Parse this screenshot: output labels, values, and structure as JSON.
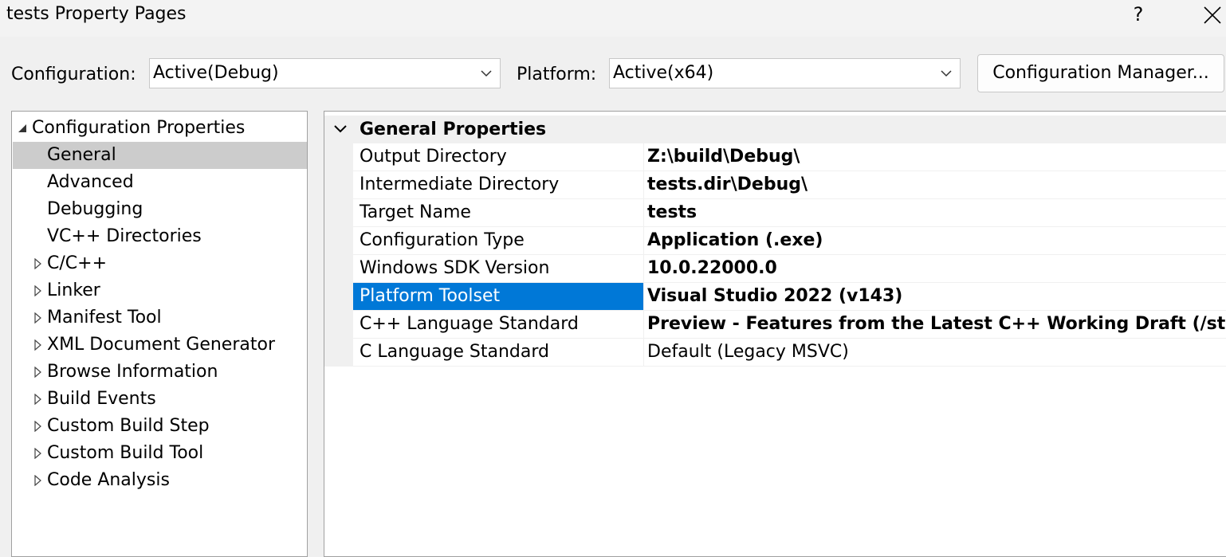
{
  "window": {
    "title": "tests Property Pages",
    "help_label": "?"
  },
  "toolbar": {
    "configuration_label": "Configuration:",
    "configuration_value": "Active(Debug)",
    "platform_label": "Platform:",
    "platform_value": "Active(x64)",
    "config_manager_label": "Configuration Manager..."
  },
  "tree": {
    "root": "Configuration Properties",
    "items": [
      {
        "label": "General",
        "selected": true,
        "expandable": false
      },
      {
        "label": "Advanced",
        "expandable": false
      },
      {
        "label": "Debugging",
        "expandable": false
      },
      {
        "label": "VC++ Directories",
        "expandable": false
      },
      {
        "label": "C/C++",
        "expandable": true
      },
      {
        "label": "Linker",
        "expandable": true
      },
      {
        "label": "Manifest Tool",
        "expandable": true
      },
      {
        "label": "XML Document Generator",
        "expandable": true
      },
      {
        "label": "Browse Information",
        "expandable": true
      },
      {
        "label": "Build Events",
        "expandable": true
      },
      {
        "label": "Custom Build Step",
        "expandable": true
      },
      {
        "label": "Custom Build Tool",
        "expandable": true
      },
      {
        "label": "Code Analysis",
        "expandable": true
      }
    ]
  },
  "properties": {
    "section_title": "General Properties",
    "rows": [
      {
        "name": "Output Directory",
        "value": "Z:\\build\\Debug\\"
      },
      {
        "name": "Intermediate Directory",
        "value": "tests.dir\\Debug\\"
      },
      {
        "name": "Target Name",
        "value": "tests"
      },
      {
        "name": "Configuration Type",
        "value": "Application (.exe)"
      },
      {
        "name": "Windows SDK Version",
        "value": "10.0.22000.0"
      },
      {
        "name": "Platform Toolset",
        "value": "Visual Studio 2022 (v143)"
      },
      {
        "name": "C++ Language Standard",
        "value": "Preview - Features from the Latest C++ Working Draft (/std:c++latest)"
      },
      {
        "name": "C Language Standard",
        "value": "Default (Legacy MSVC)"
      }
    ]
  },
  "colors": {
    "selection": "#0078d7",
    "tree_selection": "#cccccc",
    "background": "#f0f0f0"
  }
}
